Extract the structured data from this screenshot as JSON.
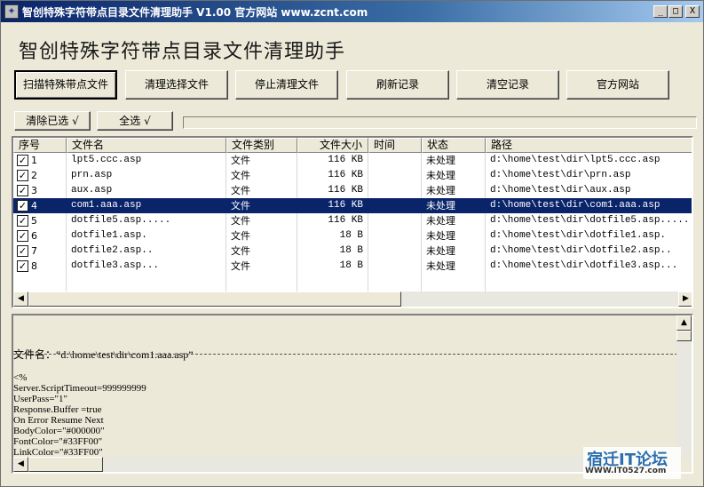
{
  "window": {
    "title": "智创特殊字符带点目录文件清理助手 V1.00 官方网站 www.zcnt.com",
    "minimize": "_",
    "maximize": "□",
    "close": "X"
  },
  "app_title": "智创特殊字符带点目录文件清理助手",
  "toolbar": {
    "scan": "扫描特殊带点文件",
    "clean_selected": "清理选择文件",
    "stop_clean": "停止清理文件",
    "refresh": "刷新记录",
    "clear_records": "清空记录",
    "official_site": "官方网站"
  },
  "selection": {
    "clear_selected": "清除已选 √",
    "select_all": "全选 √"
  },
  "list": {
    "columns": [
      "序号",
      "文件名",
      "文件类别",
      "文件大小",
      "时间",
      "状态",
      "路径"
    ],
    "rows": [
      {
        "index": "1",
        "name": "lpt5.ccc.asp",
        "type": "文件",
        "size": "116 KB",
        "time": "",
        "status": "未处理",
        "path": "d:\\home\\test\\dir\\lpt5.ccc.asp",
        "checked": true
      },
      {
        "index": "2",
        "name": "prn.asp",
        "type": "文件",
        "size": "116 KB",
        "time": "",
        "status": "未处理",
        "path": "d:\\home\\test\\dir\\prn.asp",
        "checked": true
      },
      {
        "index": "3",
        "name": "aux.asp",
        "type": "文件",
        "size": "116 KB",
        "time": "",
        "status": "未处理",
        "path": "d:\\home\\test\\dir\\aux.asp",
        "checked": true
      },
      {
        "index": "4",
        "name": "com1.aaa.asp",
        "type": "文件",
        "size": "116 KB",
        "time": "",
        "status": "未处理",
        "path": "d:\\home\\test\\dir\\com1.aaa.asp",
        "checked": true,
        "selected": true
      },
      {
        "index": "5",
        "name": "dotfile5.asp.....",
        "type": "文件",
        "size": "116 KB",
        "time": "",
        "status": "未处理",
        "path": "d:\\home\\test\\dir\\dotfile5.asp.....",
        "checked": true
      },
      {
        "index": "6",
        "name": "dotfile1.asp.",
        "type": "文件",
        "size": "18 B",
        "time": "",
        "status": "未处理",
        "path": "d:\\home\\test\\dir\\dotfile1.asp.",
        "checked": true
      },
      {
        "index": "7",
        "name": "dotfile2.asp..",
        "type": "文件",
        "size": "18 B",
        "time": "",
        "status": "未处理",
        "path": "d:\\home\\test\\dir\\dotfile2.asp..",
        "checked": true
      },
      {
        "index": "8",
        "name": "dotfile3.asp...",
        "type": "文件",
        "size": "18 B",
        "time": "",
        "status": "未处理",
        "path": "d:\\home\\test\\dir\\dotfile3.asp...",
        "checked": true
      }
    ]
  },
  "preview": {
    "filename_line": "文件名：“d:\\home\\test\\dir\\com1.aaa.asp”",
    "code_lines": [
      "<%",
      "Server.ScriptTimeout=999999999",
      "UserPass=\"1\"",
      "Response.Buffer =true",
      "On Error Resume Next",
      "BodyColor=\"#000000\"",
      "FontColor=\"#33FF00\"",
      "LinkColor=\"#33FF00\""
    ]
  },
  "watermark": {
    "main": "宿迁IT论坛",
    "sub": "WWW.IT0527.com"
  },
  "colors": {
    "titlebar": "#0a246a",
    "selected_row": "#0a246a",
    "face": "#ece9d8"
  }
}
